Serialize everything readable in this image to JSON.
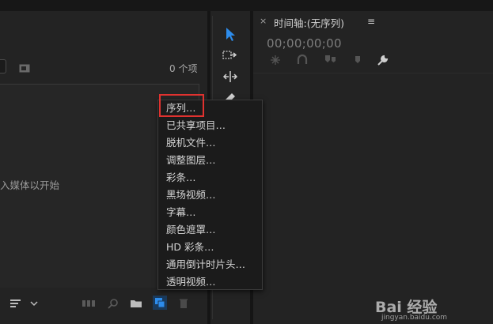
{
  "project_panel": {
    "item_count": "0 个项",
    "empty_hint": "入媒体以开始"
  },
  "timeline": {
    "close_glyph": "×",
    "title": "时间轴:(无序列)",
    "menu_glyph": "≡",
    "timecode": "00;00;00;00"
  },
  "context_menu": {
    "items": [
      "序列…",
      "已共享项目…",
      "脱机文件…",
      "调整图层…",
      "彩条…",
      "黑场视频…",
      "字幕…",
      "颜色遮罩…",
      "HD 彩条…",
      "通用倒计时片头…",
      "透明视频…"
    ],
    "highlighted_index": 0
  },
  "watermark": {
    "logo": "Bai 经验",
    "url": "jingyan.baidu.com"
  },
  "colors": {
    "accent_blue": "#2d8ceb",
    "highlight_red": "#e0322f"
  },
  "icons": {
    "tools": [
      "selection-tool-icon",
      "track-select-icon",
      "ripple-edit-icon",
      "razor-icon"
    ],
    "timeline": [
      "snap-icon",
      "linked-selection-icon",
      "add-marker-icon",
      "marker-icon",
      "wrench-icon"
    ],
    "bottom_bar": [
      "sort-icon",
      "chevron-down-icon",
      "storyboard-icon",
      "find-icon",
      "new-bin-icon",
      "new-item-icon",
      "trash-icon"
    ]
  }
}
